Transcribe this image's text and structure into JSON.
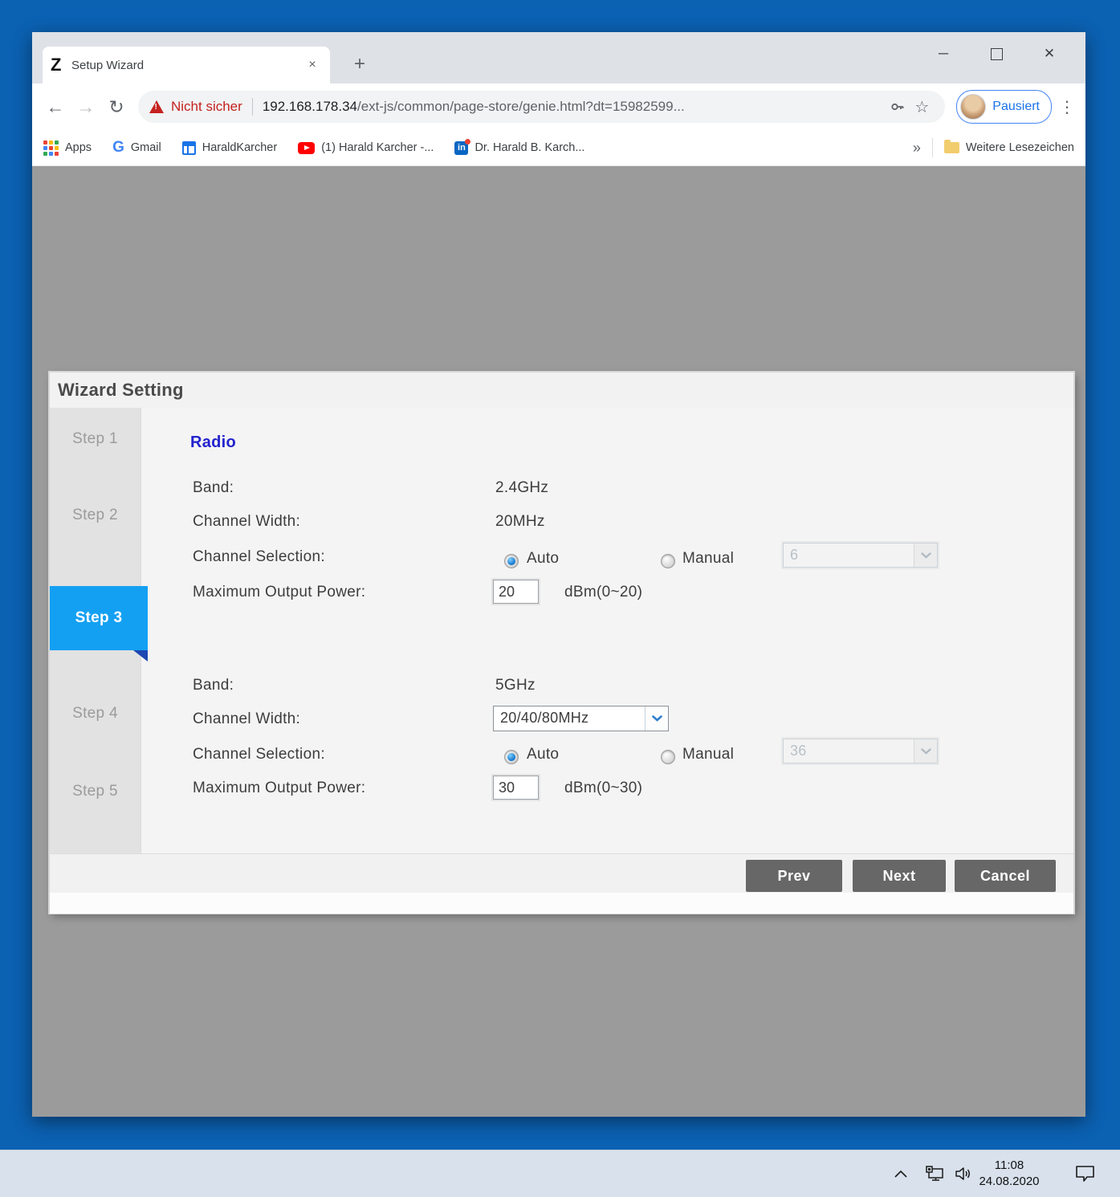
{
  "taskbar": {
    "time": "11:08",
    "date": "24.08.2020"
  },
  "browser": {
    "tab_title": "Setup Wizard",
    "favicon_letter": "Z",
    "new_tab": "+",
    "close_tab": "×",
    "back": "←",
    "forward": "→",
    "reload": "↻",
    "security_label": "Nicht sicher",
    "url_domain": "192.168.178.34",
    "url_path": "/ext-js/common/page-store/genie.html?dt=15982599...",
    "star": "☆",
    "menu_dots": "⋮",
    "minimize": "─",
    "close_window": "✕",
    "profile_label": "Pausiert",
    "bookmarks": {
      "apps": "Apps",
      "gmail": "Gmail",
      "gmail_letter": "G",
      "haraldkarcher": "HaraldKarcher",
      "youtube": "(1) Harald Karcher -...",
      "linkedin": "Dr. Harald B. Karch...",
      "linkedin_letters": "in",
      "more": "»",
      "other_bookmarks": "Weitere Lesezeichen"
    }
  },
  "wizard": {
    "title": "Wizard Setting",
    "steps": [
      {
        "label": "Step 1"
      },
      {
        "label": "Step 2"
      },
      {
        "label": "Step 3"
      },
      {
        "label": "Step 4"
      },
      {
        "label": "Step 5"
      }
    ],
    "section_title": "Radio",
    "labels": {
      "band": "Band:",
      "channel_width": "Channel Width:",
      "channel_selection": "Channel Selection:",
      "max_power": "Maximum Output Power:",
      "auto": "Auto",
      "manual": "Manual"
    },
    "radio24": {
      "band": "2.4GHz",
      "channel_width": "20MHz",
      "channel_option": "6",
      "power_value": "20",
      "power_range": "dBm(0~20)"
    },
    "radio5": {
      "band": "5GHz",
      "channel_width": "20/40/80MHz",
      "channel_option": "36",
      "power_value": "30",
      "power_range": "dBm(0~30)"
    },
    "buttons": {
      "prev": "Prev",
      "next": "Next",
      "cancel": "Cancel"
    }
  },
  "colors": {
    "desktop_blue": "#0b61b2",
    "step_active_blue": "#14a0f2",
    "step_fold_blue": "#1d47b2",
    "section_title_blue": "#2323cd",
    "button_gray": "#676767",
    "danger_red": "#c5221f",
    "profile_blue": "#1a73e8"
  }
}
